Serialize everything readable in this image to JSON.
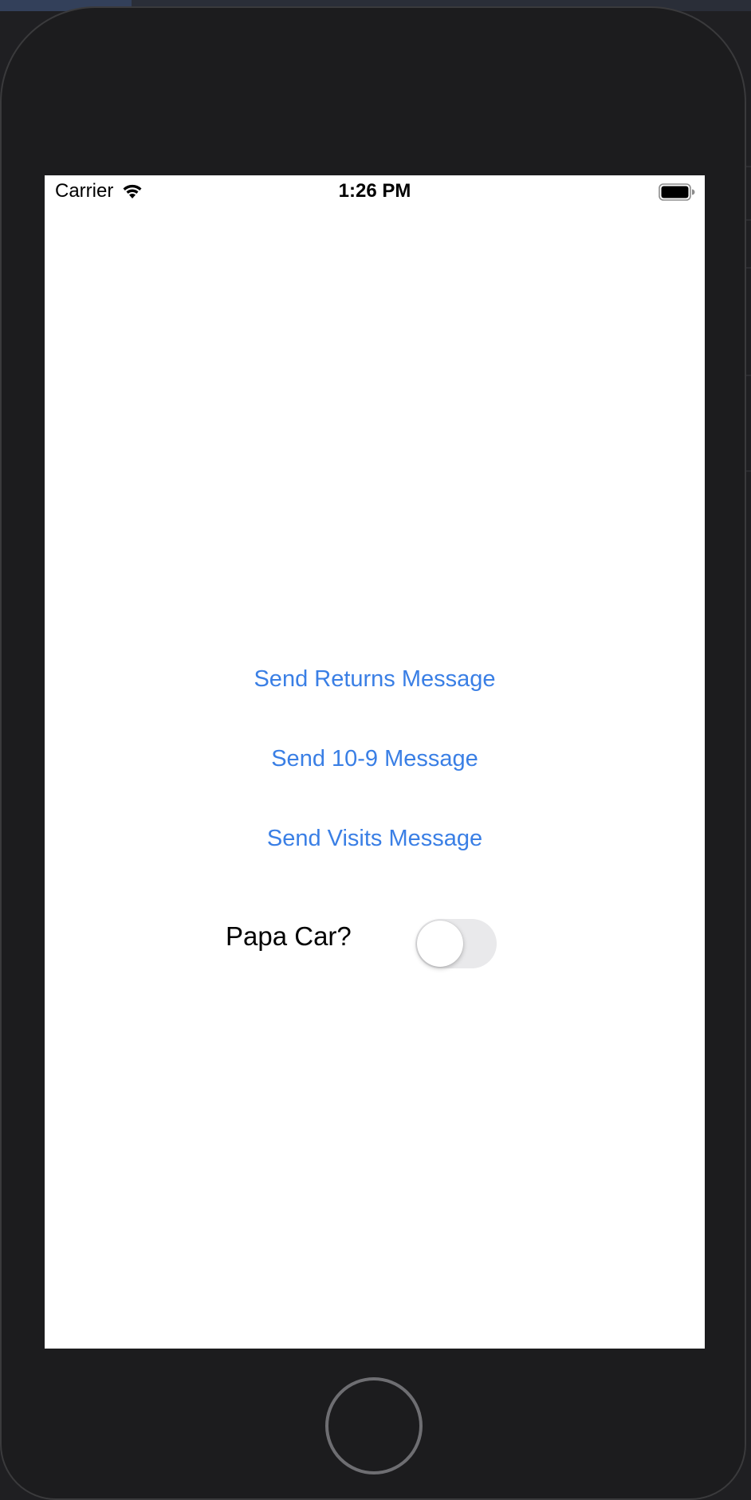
{
  "status_bar": {
    "carrier": "Carrier",
    "time": "1:26 PM",
    "wifi_icon": "wifi-icon",
    "battery_icon": "battery-full-icon"
  },
  "buttons": {
    "returns": "Send Returns Message",
    "ten_nine": "Send 10-9 Message",
    "visits": "Send Visits Message"
  },
  "toggle": {
    "label": "Papa Car?",
    "is_on": false
  },
  "device": {
    "home_button_icon": "home-button"
  },
  "colors": {
    "accent": "#3a7fe5",
    "toggle_off_track": "#e9e9eb",
    "device_body": "#1c1c1e"
  }
}
